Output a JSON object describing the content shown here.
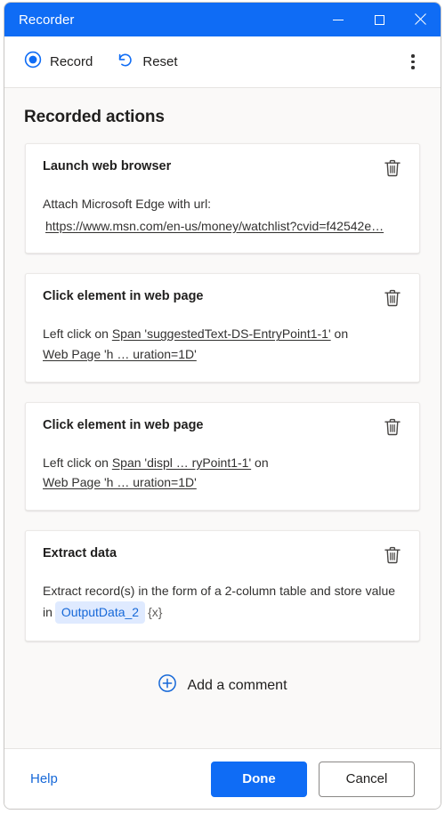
{
  "window": {
    "title": "Recorder",
    "accent_color": "#0f6cf5",
    "minimize_label": "Minimize",
    "maximize_label": "Maximize",
    "close_label": "Close"
  },
  "toolbar": {
    "record_label": "Record",
    "reset_label": "Reset",
    "more_label": "More options"
  },
  "main": {
    "section_title": "Recorded actions",
    "actions": [
      {
        "title": "Launch web browser",
        "text_before": "Attach Microsoft Edge with url:",
        "link": "https://www.msn.com/en-us/money/watchlist?cvid=f42542e…",
        "delete_label": "Delete action"
      },
      {
        "title": "Click element in web page",
        "prefix": "Left click on",
        "target": "Span 'suggestedText-DS-EntryPoint1-1'",
        "middle": "on",
        "page": "Web Page 'h … uration=1D'",
        "delete_label": "Delete action"
      },
      {
        "title": "Click element in web page",
        "prefix": "Left click on",
        "target": "Span 'displ … ryPoint1-1'",
        "middle": "on",
        "page": "Web Page 'h … uration=1D'",
        "delete_label": "Delete action"
      },
      {
        "title": "Extract data",
        "text_before": "Extract record(s) in the form of a 2-column table and store value in",
        "variable": "OutputData_2",
        "variable_suffix": "{x}",
        "variable_bg": "#dfeaff",
        "variable_fg": "#1668d8",
        "delete_label": "Delete action"
      }
    ],
    "add_comment_label": "Add a comment"
  },
  "footer": {
    "help_label": "Help",
    "done_label": "Done",
    "cancel_label": "Cancel"
  }
}
